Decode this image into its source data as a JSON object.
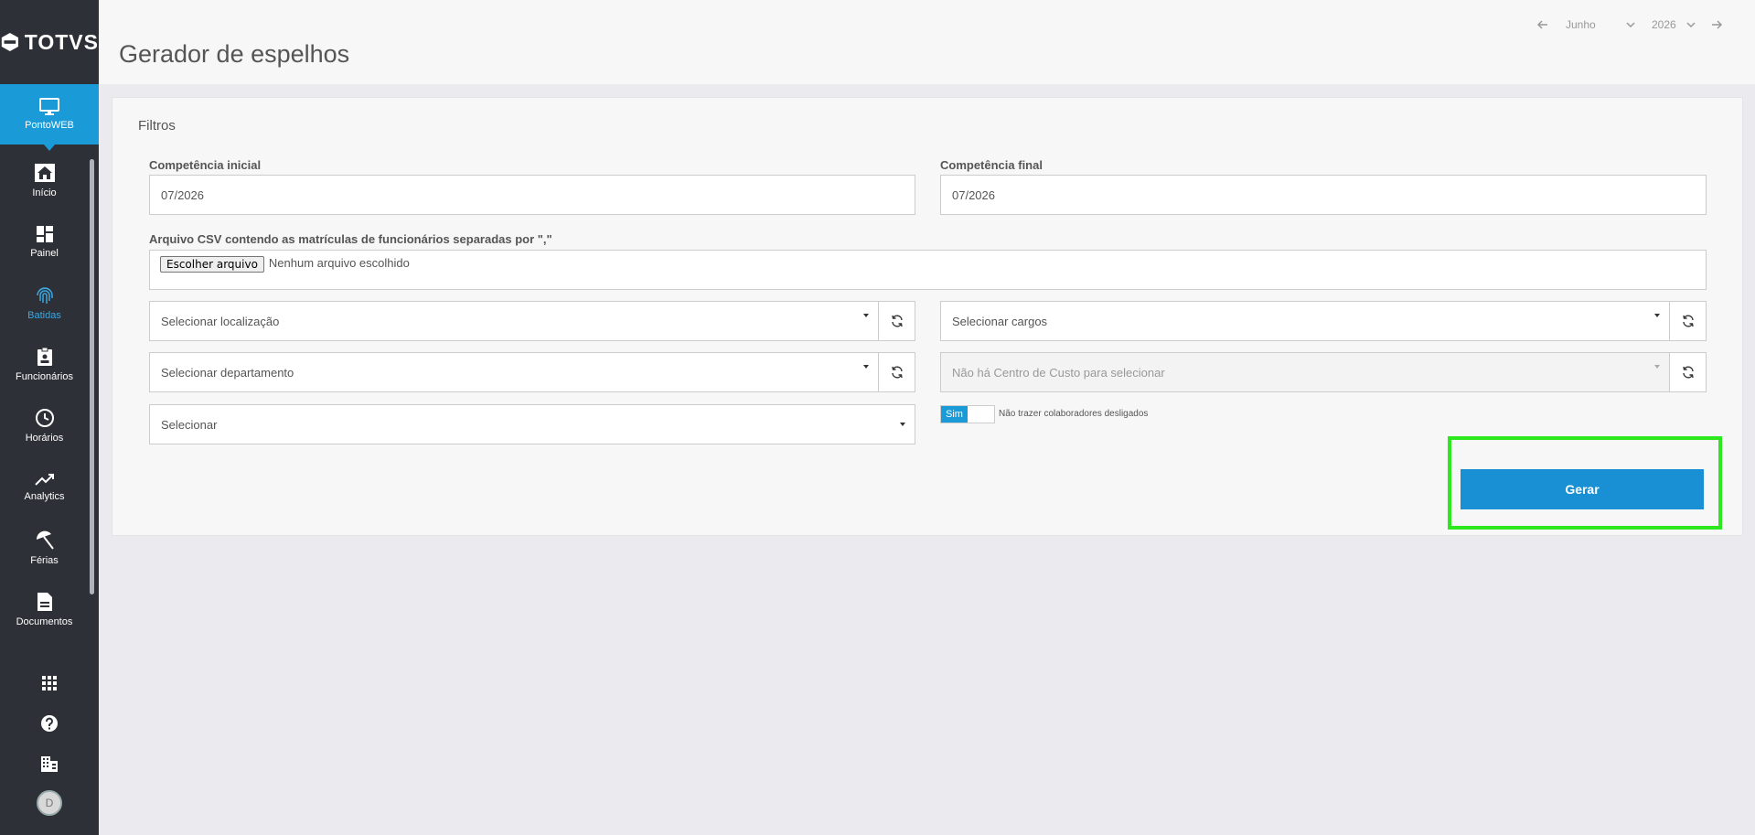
{
  "brand": {
    "name": "TOTVS"
  },
  "sidebar": {
    "active": {
      "label": "PontoWEB",
      "icon": "monitor-icon"
    },
    "items": [
      {
        "label": "Início",
        "icon": "home-icon"
      },
      {
        "label": "Painel",
        "icon": "dashboard-icon"
      },
      {
        "label": "Batidas",
        "icon": "fingerprint-icon"
      },
      {
        "label": "Funcionários",
        "icon": "badge-icon"
      },
      {
        "label": "Horários",
        "icon": "clock-icon"
      },
      {
        "label": "Analytics",
        "icon": "trending-up-icon"
      },
      {
        "label": "Férias",
        "icon": "beach-umbrella-icon"
      },
      {
        "label": "Documentos",
        "icon": "document-icon"
      }
    ],
    "bottom": [
      {
        "icon": "apps-grid-icon"
      },
      {
        "icon": "help-icon"
      },
      {
        "icon": "building-icon"
      },
      {
        "avatar_initial": "D"
      }
    ],
    "colors": {
      "background": "#2d3037",
      "active": "#1a9ad6",
      "highlight_text": "#3ba7e0"
    }
  },
  "header": {
    "title": "Gerador de espelhos",
    "date_nav": {
      "month": "Junho",
      "year": "2026"
    }
  },
  "card": {
    "title": "Filtros",
    "competencia_inicial": {
      "label": "Competência inicial",
      "value": "07/2026"
    },
    "competencia_final": {
      "label": "Competência final",
      "value": "07/2026"
    },
    "csv": {
      "label": "Arquivo CSV contendo as matrículas de funcionários separadas por \",\"",
      "button": "Escolher arquivo",
      "status": "Nenhum arquivo escolhido"
    },
    "selects": {
      "localizacao": "Selecionar localização",
      "cargos": "Selecionar cargos",
      "departamento": "Selecionar departamento",
      "centro_custo": "Não há Centro de Custo para selecionar",
      "generic": "Selecionar"
    },
    "toggle": {
      "on_label": "Sim",
      "label": "Não trazer colaboradores desligados"
    },
    "submit": {
      "label": "Gerar",
      "color": "#1a90d4"
    },
    "highlight_color": "#2ee81e"
  }
}
